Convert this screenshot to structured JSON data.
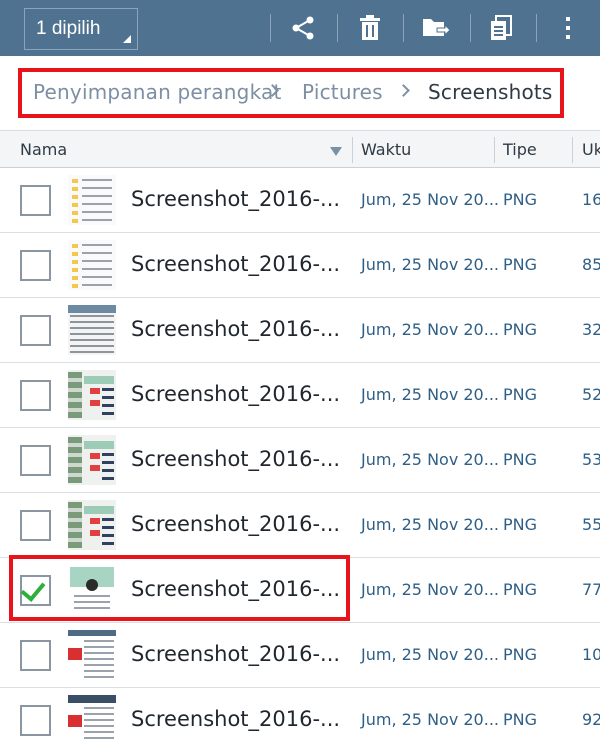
{
  "toolbar": {
    "selection_label": "1 dipilih",
    "actions": [
      {
        "icon": "share-icon"
      },
      {
        "icon": "trash-icon"
      },
      {
        "icon": "move-folder-icon"
      },
      {
        "icon": "copy-icon"
      },
      {
        "icon": "more-vert-icon"
      }
    ]
  },
  "breadcrumb": {
    "items": [
      "Penyimpanan perangkat",
      "Pictures",
      "Screenshots"
    ]
  },
  "columns": {
    "name": "Nama",
    "time": "Waktu",
    "type": "Tipe",
    "size": "Uk"
  },
  "rows": [
    {
      "name": "Screenshot_2016-...",
      "time": "Jum, 25 Nov 20...",
      "type": "PNG",
      "size": "16",
      "checked": false,
      "thumb": "folder-list"
    },
    {
      "name": "Screenshot_2016-...",
      "time": "Jum, 25 Nov 20...",
      "type": "PNG",
      "size": "85",
      "checked": false,
      "thumb": "folder-list"
    },
    {
      "name": "Screenshot_2016-...",
      "time": "Jum, 25 Nov 20...",
      "type": "PNG",
      "size": "32",
      "checked": false,
      "thumb": "web-page"
    },
    {
      "name": "Screenshot_2016-...",
      "time": "Jum, 25 Nov 20...",
      "type": "PNG",
      "size": "52",
      "checked": false,
      "thumb": "profile-page"
    },
    {
      "name": "Screenshot_2016-...",
      "time": "Jum, 25 Nov 20...",
      "type": "PNG",
      "size": "53",
      "checked": false,
      "thumb": "profile-page"
    },
    {
      "name": "Screenshot_2016-...",
      "time": "Jum, 25 Nov 20...",
      "type": "PNG",
      "size": "55",
      "checked": false,
      "thumb": "profile-page"
    },
    {
      "name": "Screenshot_2016-...",
      "time": "Jum, 25 Nov 20...",
      "type": "PNG",
      "size": "77",
      "checked": true,
      "thumb": "avatar-card"
    },
    {
      "name": "Screenshot_2016-...",
      "time": "Jum, 25 Nov 20...",
      "type": "PNG",
      "size": "10",
      "checked": false,
      "thumb": "article"
    },
    {
      "name": "Screenshot_2016-...",
      "time": "Jum, 25 Nov 20...",
      "type": "PNG",
      "size": "92",
      "checked": false,
      "thumb": "article-dark"
    }
  ],
  "colors": {
    "toolbar_bg": "#4f7291",
    "highlight": "#e8141b",
    "check": "#2eaf3c",
    "meta_text": "#2f5f86"
  }
}
